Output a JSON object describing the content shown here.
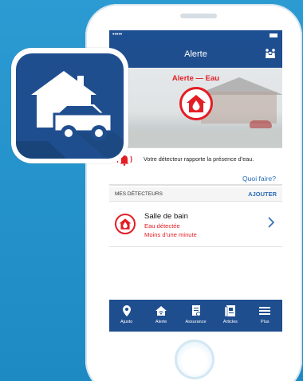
{
  "status_bar": {
    "signal": "•••••"
  },
  "header": {
    "title": "Alerte",
    "action_icon": "family-icon"
  },
  "alert": {
    "title": "Alerte — Eau",
    "icon": "water-house-icon",
    "color": "#e31d25"
  },
  "notification": {
    "icon": "bell-ringing-icon",
    "message": "Votre détecteur rapporte la présence d’eau.",
    "link_label": "Quoi faire?"
  },
  "detectors": {
    "section_title": "MES DÉTECTEURS",
    "add_label": "AJOUTER",
    "items": [
      {
        "name": "Salle de bain",
        "status": "Eau détectée",
        "time": "Moins d’une minute",
        "icon": "water-house-icon"
      }
    ]
  },
  "tabs": [
    {
      "label": "Ajusto",
      "icon": "pin-icon"
    },
    {
      "label": "Alerte",
      "icon": "house-wifi-icon"
    },
    {
      "label": "Assurance",
      "icon": "policy-icon"
    },
    {
      "label": "Articles",
      "icon": "articles-icon"
    },
    {
      "label": "Plus",
      "icon": "menu-icon"
    }
  ],
  "colors": {
    "brand": "#1f4e8f",
    "alert": "#e31d25",
    "link": "#2b6db6",
    "background": "#2c9bd2"
  }
}
